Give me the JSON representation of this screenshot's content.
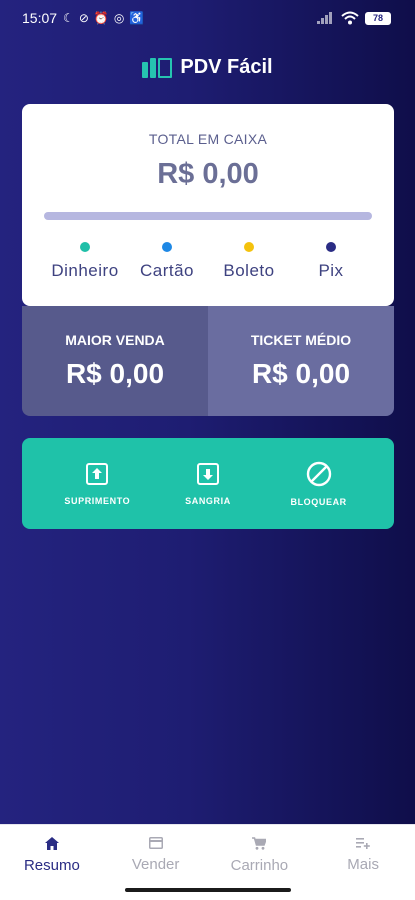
{
  "statusbar": {
    "time": "15:07",
    "battery": "78"
  },
  "app": {
    "name": "PDV Fácil"
  },
  "total_card": {
    "label": "TOTAL EM CAIXA",
    "value": "R$ 0,00",
    "methods": [
      {
        "label": "Dinheiro",
        "color": "#1fbfa8"
      },
      {
        "label": "Cartão",
        "color": "#1e88e5"
      },
      {
        "label": "Boleto",
        "color": "#f4c20d"
      },
      {
        "label": "Pix",
        "color": "#2a2c84"
      }
    ]
  },
  "stats": {
    "maior_venda": {
      "label": "MAIOR VENDA",
      "value": "R$ 0,00"
    },
    "ticket_medio": {
      "label": "TICKET MÉDIO",
      "value": "R$ 0,00"
    }
  },
  "actions": [
    {
      "label": "SUPRIMENTO",
      "icon": "upload-box-icon"
    },
    {
      "label": "SANGRIA",
      "icon": "download-box-icon"
    },
    {
      "label": "BLOQUEAR",
      "icon": "block-icon"
    }
  ],
  "nav": [
    {
      "label": "Resumo",
      "icon": "home-icon",
      "active": true
    },
    {
      "label": "Vender",
      "icon": "card-icon",
      "active": false
    },
    {
      "label": "Carrinho",
      "icon": "cart-icon",
      "active": false
    },
    {
      "label": "Mais",
      "icon": "list-add-icon",
      "active": false
    }
  ],
  "colors": {
    "background": "#1e1d72",
    "accent": "#1fc2a9",
    "nav_active": "#2a2c84"
  }
}
